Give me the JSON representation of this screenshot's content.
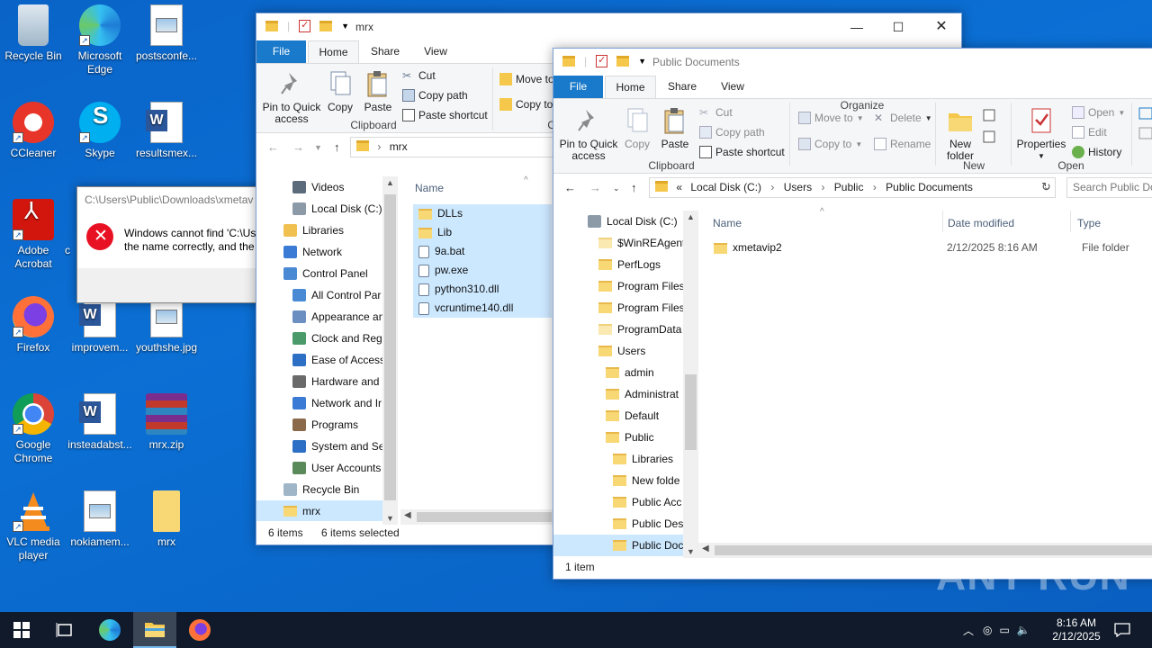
{
  "desktop": {
    "icons": [
      {
        "label": "Recycle Bin",
        "icon": "recycle-bin-icon"
      },
      {
        "label": "Microsoft Edge",
        "icon": "edge-icon"
      },
      {
        "label": "postsconfe...",
        "icon": "image-file-icon"
      },
      {
        "label": "CCleaner",
        "icon": "ccleaner-icon"
      },
      {
        "label": "Skype",
        "icon": "skype-icon"
      },
      {
        "label": "resultsmex...",
        "icon": "word-doc-icon"
      },
      {
        "label": "Adobe Acrobat",
        "icon": "acrobat-icon"
      },
      {
        "label": "c",
        "icon": "partial-icon"
      },
      {
        "label": "Firefox",
        "icon": "firefox-icon"
      },
      {
        "label": "improvem...",
        "icon": "word-doc-icon"
      },
      {
        "label": "youthshe.jpg",
        "icon": "image-file-icon"
      },
      {
        "label": "Google Chrome",
        "icon": "chrome-icon"
      },
      {
        "label": "insteadabst...",
        "icon": "word-doc-icon"
      },
      {
        "label": "mrx.zip",
        "icon": "winrar-archive-icon"
      },
      {
        "label": "VLC media player",
        "icon": "vlc-icon"
      },
      {
        "label": "nokiamem...",
        "icon": "image-file-icon"
      },
      {
        "label": "mrx",
        "icon": "folder-icon"
      }
    ]
  },
  "error_dialog": {
    "title": "C:\\Users\\Public\\Downloads\\xmetav",
    "message_line1": "Windows cannot find 'C:\\Us",
    "message_line2": "the name correctly, and the"
  },
  "mrx_window": {
    "title": "mrx",
    "tabs": [
      "File",
      "Home",
      "Share",
      "View"
    ],
    "ribbon": {
      "pin": "Pin to Quick access",
      "copy": "Copy",
      "paste": "Paste",
      "cut": "Cut",
      "copy_path": "Copy path",
      "paste_shortcut": "Paste shortcut",
      "group_clipboard": "Clipboard",
      "move_to": "Move to",
      "copy_to": "Copy to",
      "group_org_partial": "O"
    },
    "address": "mrx",
    "nav": [
      {
        "label": "Videos",
        "icon": "videos-icon"
      },
      {
        "label": "Local Disk (C:)",
        "icon": "drive-icon"
      },
      {
        "label": "Libraries",
        "icon": "libraries-icon"
      },
      {
        "label": "Network",
        "icon": "network-icon"
      },
      {
        "label": "Control Panel",
        "icon": "control-panel-icon"
      },
      {
        "label": "All Control Par",
        "icon": "control-panel-icon"
      },
      {
        "label": "Appearance an",
        "icon": "appearance-icon"
      },
      {
        "label": "Clock and Regi",
        "icon": "clock-icon"
      },
      {
        "label": "Ease of Access",
        "icon": "ease-of-access-icon"
      },
      {
        "label": "Hardware and",
        "icon": "hardware-icon"
      },
      {
        "label": "Network and Ir",
        "icon": "network-internet-icon"
      },
      {
        "label": "Programs",
        "icon": "programs-icon"
      },
      {
        "label": "System and Se",
        "icon": "system-security-icon"
      },
      {
        "label": "User Accounts",
        "icon": "user-accounts-icon"
      },
      {
        "label": "Recycle Bin",
        "icon": "recycle-bin-icon"
      },
      {
        "label": "mrx",
        "icon": "folder-icon"
      }
    ],
    "column_name": "Name",
    "files": [
      {
        "name": "DLLs",
        "icon": "folder-icon"
      },
      {
        "name": "Lib",
        "icon": "folder-icon"
      },
      {
        "name": "9a.bat",
        "icon": "batch-file-icon"
      },
      {
        "name": "pw.exe",
        "icon": "exe-file-icon"
      },
      {
        "name": "python310.dll",
        "icon": "dll-file-icon"
      },
      {
        "name": "vcruntime140.dll",
        "icon": "dll-file-icon"
      }
    ],
    "status_items": "6 items",
    "status_selected": "6 items selected"
  },
  "public_window": {
    "title": "Public Documents",
    "tabs": [
      "File",
      "Home",
      "Share",
      "View"
    ],
    "ribbon": {
      "pin": "Pin to Quick access",
      "copy": "Copy",
      "paste": "Paste",
      "cut": "Cut",
      "copy_path": "Copy path",
      "paste_shortcut": "Paste shortcut",
      "group_clipboard": "Clipboard",
      "move_to": "Move to",
      "copy_to": "Copy to",
      "delete": "Delete",
      "rename": "Rename",
      "group_organize": "Organize",
      "new_folder": "New folder",
      "group_new": "New",
      "properties": "Properties",
      "open": "Open",
      "edit": "Edit",
      "history": "History",
      "group_open": "Open"
    },
    "breadcrumb": [
      "Local Disk (C:)",
      "Users",
      "Public",
      "Public Documents"
    ],
    "breadcrumb_prefix": "«",
    "search_placeholder": "Search Public Do",
    "nav": [
      {
        "label": "Local Disk (C:)",
        "icon": "drive-icon",
        "level": 0
      },
      {
        "label": "$WinREAgent",
        "icon": "folder-icon",
        "level": 1
      },
      {
        "label": "PerfLogs",
        "icon": "folder-icon",
        "level": 1
      },
      {
        "label": "Program Files",
        "icon": "folder-icon",
        "level": 1
      },
      {
        "label": "Program Files",
        "icon": "folder-icon",
        "level": 1
      },
      {
        "label": "ProgramData",
        "icon": "folder-icon",
        "level": 1
      },
      {
        "label": "Users",
        "icon": "folder-icon",
        "level": 1
      },
      {
        "label": "admin",
        "icon": "folder-icon",
        "level": 2
      },
      {
        "label": "Administrat",
        "icon": "folder-icon",
        "level": 2
      },
      {
        "label": "Default",
        "icon": "folder-icon",
        "level": 2
      },
      {
        "label": "Public",
        "icon": "folder-icon",
        "level": 2
      },
      {
        "label": "Libraries",
        "icon": "folder-icon",
        "level": 3
      },
      {
        "label": "New folde",
        "icon": "folder-icon",
        "level": 3
      },
      {
        "label": "Public Acc",
        "icon": "folder-icon",
        "level": 3
      },
      {
        "label": "Public Des",
        "icon": "folder-icon",
        "level": 3
      },
      {
        "label": "Public Doc",
        "icon": "folder-icon",
        "level": 3
      }
    ],
    "columns": [
      "Name",
      "Date modified",
      "Type"
    ],
    "files": [
      {
        "name": "xmetavip2",
        "date": "2/12/2025 8:16 AM",
        "type": "File folder"
      }
    ],
    "status_items": "1 item"
  },
  "taskbar": {
    "time": "8:16 AM",
    "date": "2/12/2025"
  },
  "watermark": "ANY RUN"
}
